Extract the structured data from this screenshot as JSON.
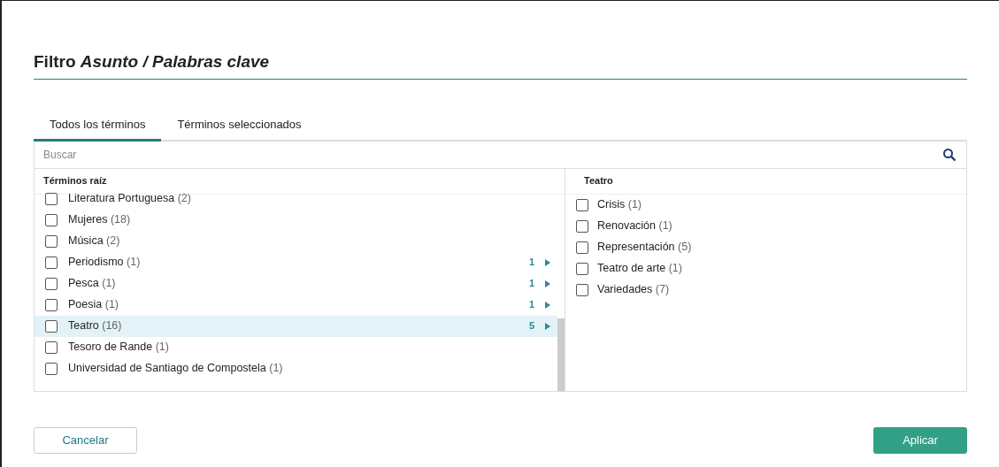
{
  "dialog": {
    "title": "Filtro *Asunto / Palabras clave*"
  },
  "tabs": [
    {
      "label": "Todos los términos",
      "selected": true
    },
    {
      "label": "Términos seleccionados",
      "selected": false
    }
  ],
  "search": {
    "placeholder": "Buscar"
  },
  "root_panel": {
    "heading": "Términos raíz",
    "items": [
      {
        "name": "Literatura Portuguesa",
        "count": "(2)",
        "checked": false,
        "selected": false
      },
      {
        "name": "Mujeres",
        "count": "(18)",
        "checked": false,
        "selected": false
      },
      {
        "name": "Música",
        "count": "(2)",
        "checked": false,
        "selected": false
      },
      {
        "name": "Periodismo",
        "count": "(1)",
        "checked": false,
        "selected": false,
        "subterms": "1"
      },
      {
        "name": "Pesca",
        "count": "(1)",
        "checked": false,
        "selected": false,
        "subterms": "1"
      },
      {
        "name": "Poesia",
        "count": "(1)",
        "checked": false,
        "selected": false,
        "subterms": "1"
      },
      {
        "name": "Teatro",
        "count": "(16)",
        "checked": false,
        "selected": true,
        "subterms": "5"
      },
      {
        "name": "Tesoro de Rande",
        "count": "(1)",
        "checked": false,
        "selected": false
      },
      {
        "name": "Universidad de Santiago de Compostela",
        "count": "(1)",
        "checked": false,
        "selected": false
      }
    ]
  },
  "child_panel": {
    "heading": "Teatro",
    "items": [
      {
        "name": "Crisis",
        "count": "(1)",
        "checked": false
      },
      {
        "name": "Renovación",
        "count": "(1)",
        "checked": false
      },
      {
        "name": "Representación",
        "count": "(5)",
        "checked": false
      },
      {
        "name": "Teatro de arte",
        "count": "(1)",
        "checked": false
      },
      {
        "name": "Variedades",
        "count": "(7)",
        "checked": false
      }
    ]
  },
  "buttons": {
    "cancel": "Cancelar",
    "apply": "Aplicar"
  }
}
